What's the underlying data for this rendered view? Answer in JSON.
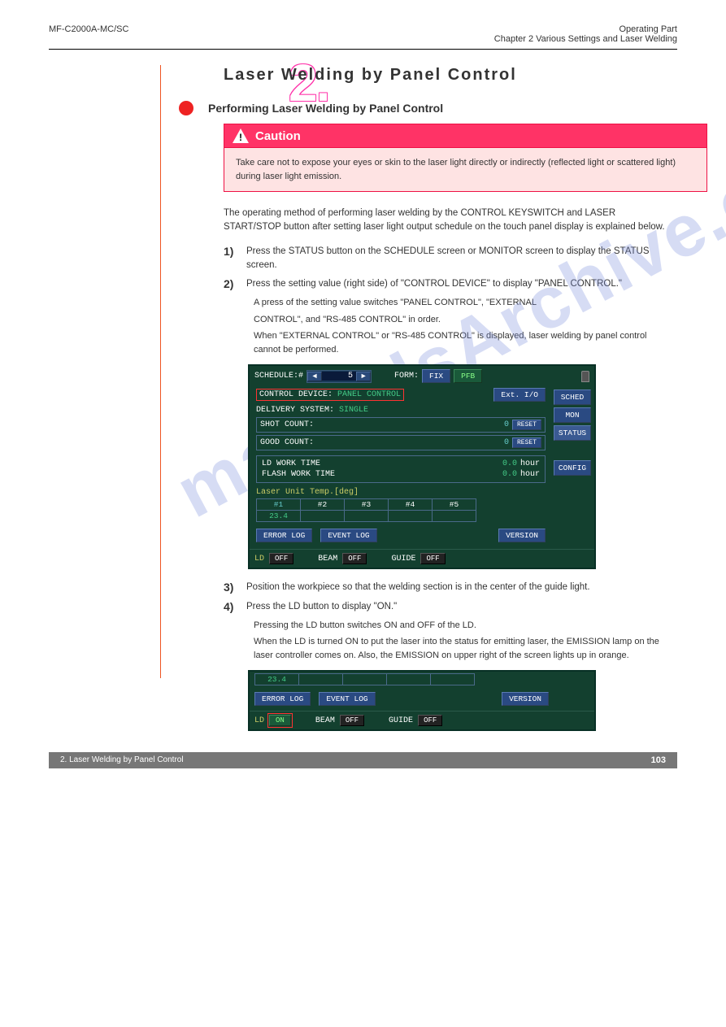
{
  "header": {
    "doc_id": "MF-C2000A-MC/SC",
    "section_cat": "Operating Part",
    "chapter_ref": "Chapter 2  Various Settings and Laser Welding"
  },
  "section_number": "2.",
  "section_title": "Laser Welding by Panel Control",
  "subsection_title": "Performing Laser Welding by Panel Control",
  "caution": {
    "label": "Caution",
    "text": "Take care not to expose your eyes or skin to the laser light directly or indirectly (reflected light or scattered light) during laser light emission."
  },
  "intro": "The operating method of performing laser welding by the CONTROL KEYSWITCH and LASER START/STOP button after setting laser light output schedule on the touch panel display is explained below.",
  "steps": [
    {
      "n": "1)",
      "text": "Press the STATUS button on the SCHEDULE screen or MONITOR screen to display the STATUS screen."
    },
    {
      "n": "2)",
      "text": "Press the setting value (right side) of \"CONTROL DEVICE\" to display \"PANEL CONTROL.\""
    }
  ],
  "notes": {
    "note1a": "A press of the setting value switches \"PANEL CONTROL\", \"EXTERNAL",
    "note1b": "CONTROL\", and \"RS-485 CONTROL\" in order.",
    "note1c": "When \"EXTERNAL CONTROL\" or \"RS-485 CONTROL\" is displayed, laser welding by panel control cannot be performed."
  },
  "screen": {
    "schedule_label": "SCHEDULE:#",
    "schedule_val": "5",
    "form_label": "FORM:",
    "fix": "FIX",
    "pfb": "PFB",
    "control_device_label": "CONTROL DEVICE:",
    "control_device_val": "PANEL CONTROL",
    "ext_io": "Ext. I/O",
    "delivery_label": "DELIVERY SYSTEM:",
    "delivery_val": "SINGLE",
    "shot_count_label": "SHOT COUNT:",
    "shot_count_val": "0",
    "good_count_label": "GOOD COUNT:",
    "good_count_val": "0",
    "reset": "RESET",
    "ld_work_label": "LD WORK TIME",
    "ld_work_val": "0.0",
    "flash_work_label": "FLASH WORK TIME",
    "flash_work_val": "0.0",
    "hour": "hour",
    "temp_label": "Laser Unit Temp.[deg]",
    "cols": [
      "#1",
      "#2",
      "#3",
      "#4",
      "#5"
    ],
    "temp_val": "23.4",
    "error_log": "ERROR LOG",
    "event_log": "EVENT LOG",
    "version": "VERSION",
    "ld": "LD",
    "beam": "BEAM",
    "guide": "GUIDE",
    "off": "OFF",
    "on": "ON",
    "tabs": {
      "sched": "SCHED",
      "mon": "MON",
      "status": "STATUS",
      "config": "CONFIG"
    }
  },
  "post_screen": {
    "step3_n": "3)",
    "step3_text": "Position the workpiece so that the welding section is in the center of the guide light.",
    "step4_n": "4)",
    "step4_text": "Press the LD button to display \"ON.\"",
    "note4a": "Pressing the LD button switches ON and OFF of the LD.",
    "note4b": "When the LD is turned ON to put the laser into the status for emitting laser, the EMISSION lamp on the laser controller comes on. Also, the EMISSION on upper right of the screen lights up in orange."
  },
  "footer": {
    "left": "2. Laser Welding by Panel Control",
    "right": "103"
  }
}
